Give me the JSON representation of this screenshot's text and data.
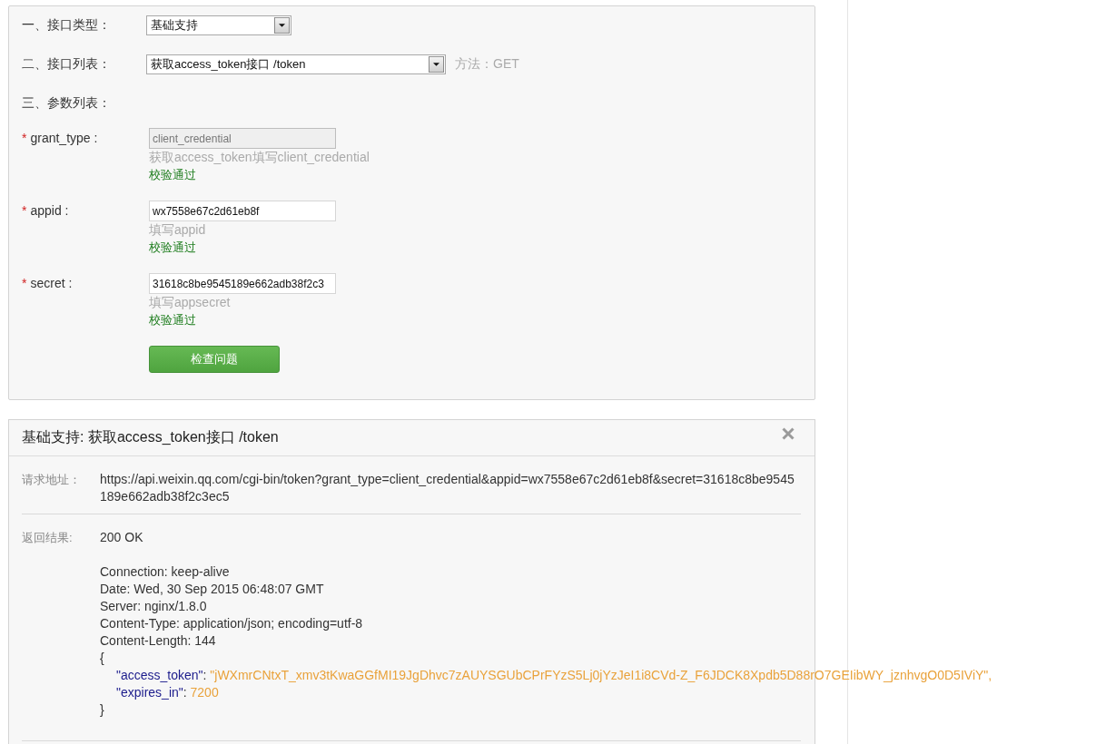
{
  "api_form": {
    "interface_type": {
      "label": "一、接口类型：",
      "value": "基础支持"
    },
    "interface_list": {
      "label": "二、接口列表：",
      "value": "获取access_token接口 /token",
      "method": "方法：GET"
    },
    "params_heading": "三、参数列表：",
    "params": [
      {
        "required_mark": "*",
        "name": "grant_type :",
        "value": "client_credential",
        "disabled": true,
        "hint": "获取access_token填写client_credential",
        "status": {
          "text": "校验通过",
          "valid": true
        }
      },
      {
        "required_mark": "*",
        "name": "appid :",
        "value": "wx7558e67c2d61eb8f",
        "disabled": false,
        "hint": "填写appid",
        "status": {
          "text": "校验通过",
          "valid": true
        }
      },
      {
        "required_mark": "*",
        "name": "secret :",
        "value": "31618c8be9545189e662adb38f2c3",
        "disabled": false,
        "hint": "填写appsecret",
        "status": {
          "text": "校验通过",
          "valid": true
        }
      }
    ],
    "submit_button": "检查问题"
  },
  "result_panel": {
    "title": "基础支持: 获取access_token接口 /token",
    "request": {
      "label": "请求地址：",
      "url": "https://api.weixin.qq.com/cgi-bin/token?grant_type=client_credential&appid=wx7558e67c2d61eb8f&secret=31618c8be9545189e662adb38f2c3ec5"
    },
    "response": {
      "label": "返回结果:",
      "status": "200 OK",
      "headers": [
        "Connection: keep-alive",
        "Date: Wed, 30 Sep 2015 06:48:07 GMT",
        "Server: nginx/1.8.0",
        "Content-Type: application/json; encoding=utf-8",
        "Content-Length: 144"
      ],
      "body": [
        {
          "kind": "brace",
          "text": "{"
        },
        {
          "kind": "pair",
          "key": "\"access_token\"",
          "punct": ": ",
          "value": "\"jWXmrCNtxT_xmv3tKwaGGfMI19JgDhvc7zAUYSGUbCPrFYzS5Lj0jYzJeI1i8CVd-Z_F6JDCK8Xpdb5D88rO7GEIibWY_jznhvgO0D5IViY\","
        },
        {
          "kind": "pair",
          "key": "\"expires_in\"",
          "punct": ": ",
          "value": "7200"
        },
        {
          "kind": "brace",
          "text": "}"
        }
      ]
    }
  }
}
